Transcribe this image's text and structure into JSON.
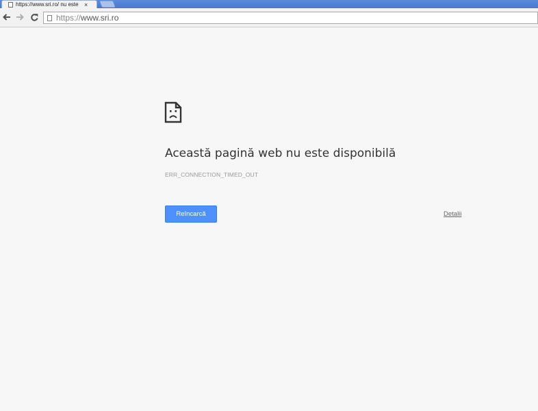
{
  "tab": {
    "title": "https://www.sri.ro/ nu este",
    "close_glyph": "×",
    "favicon": "page-icon"
  },
  "toolbar": {
    "back_icon": "back-arrow-icon",
    "forward_icon": "forward-arrow-icon",
    "reload_icon": "reload-icon",
    "url_scheme": "https://",
    "url_host": "www.sri.ro"
  },
  "error_page": {
    "icon": "sad-page-icon",
    "heading": "Această pagină web nu este disponibilă",
    "error_code": "ERR_CONNECTION_TIMED_OUT",
    "reload_label": "Reîncarcă",
    "details_label": "Detalii"
  },
  "colors": {
    "tabstrip": "#4878cc",
    "page_background": "#f7f7f7",
    "button": "#4d90fe"
  }
}
